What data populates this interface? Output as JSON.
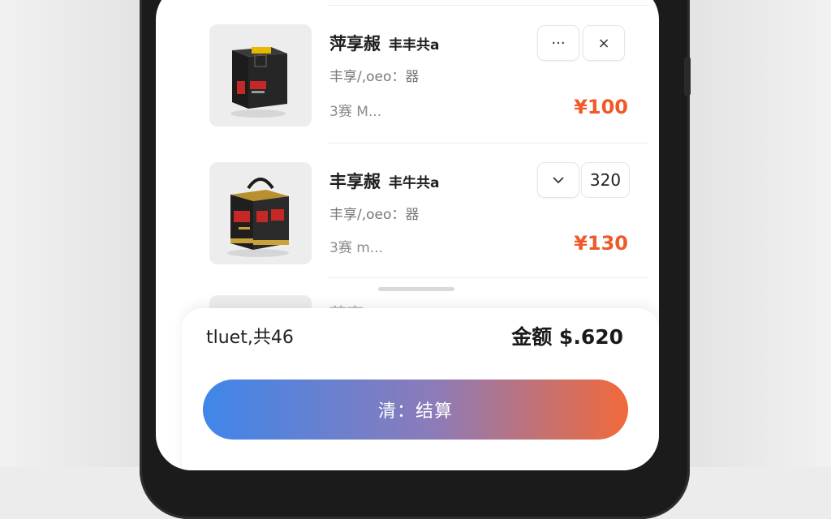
{
  "cart": {
    "items": [
      {
        "title": "萍享赧",
        "subtitle": "丰丰共a",
        "meta": "丰享/,oeo：器",
        "meta2": "3赛 M...",
        "price": "¥100",
        "actions": {
          "more": "···",
          "remove": "×"
        }
      },
      {
        "title": "丰享赧",
        "subtitle": "丰牛共a",
        "meta": "丰享/,oeo：器",
        "meta2": "3赛 m...",
        "price": "¥130",
        "quantity": "320",
        "actions": {
          "dropdown": "chevron-down"
        }
      },
      {
        "title": "萍享...",
        "partial": true
      }
    ]
  },
  "summary": {
    "left": "tluet,共46",
    "right": "金额 $.620"
  },
  "checkout_button": {
    "label": "清：结算"
  },
  "colors": {
    "price": "#ef5a28",
    "gradient_start": "#3f86ea",
    "gradient_end": "#f2693a"
  }
}
